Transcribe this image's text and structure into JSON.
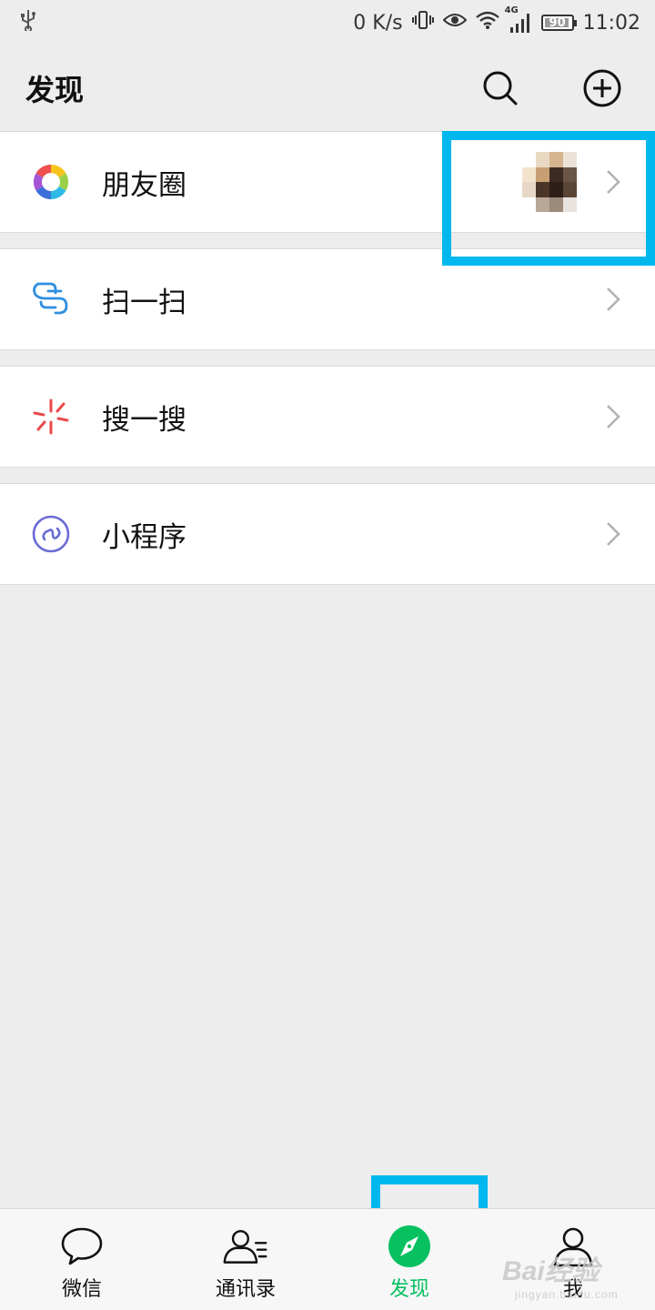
{
  "status_bar": {
    "network_speed": "0 K/s",
    "network_type": "4G",
    "battery": "90",
    "time": "11:02"
  },
  "header": {
    "title": "发现"
  },
  "list": {
    "items": [
      {
        "label": "朋友圈",
        "icon": "moments-icon"
      },
      {
        "label": "扫一扫",
        "icon": "scan-icon"
      },
      {
        "label": "搜一搜",
        "icon": "search-sparkle-icon"
      },
      {
        "label": "小程序",
        "icon": "mini-program-icon"
      }
    ]
  },
  "tabbar": {
    "tabs": [
      {
        "label": "微信",
        "icon": "chat-icon"
      },
      {
        "label": "通讯录",
        "icon": "contacts-icon"
      },
      {
        "label": "发现",
        "icon": "compass-icon",
        "active": true
      },
      {
        "label": "我",
        "icon": "me-icon"
      }
    ]
  },
  "watermark": {
    "brand": "Bai经验",
    "url": "jingyan.baidu.com"
  },
  "colors": {
    "accent_green": "#07c160",
    "highlight_blue": "#00b7ee",
    "background": "#ededed"
  }
}
